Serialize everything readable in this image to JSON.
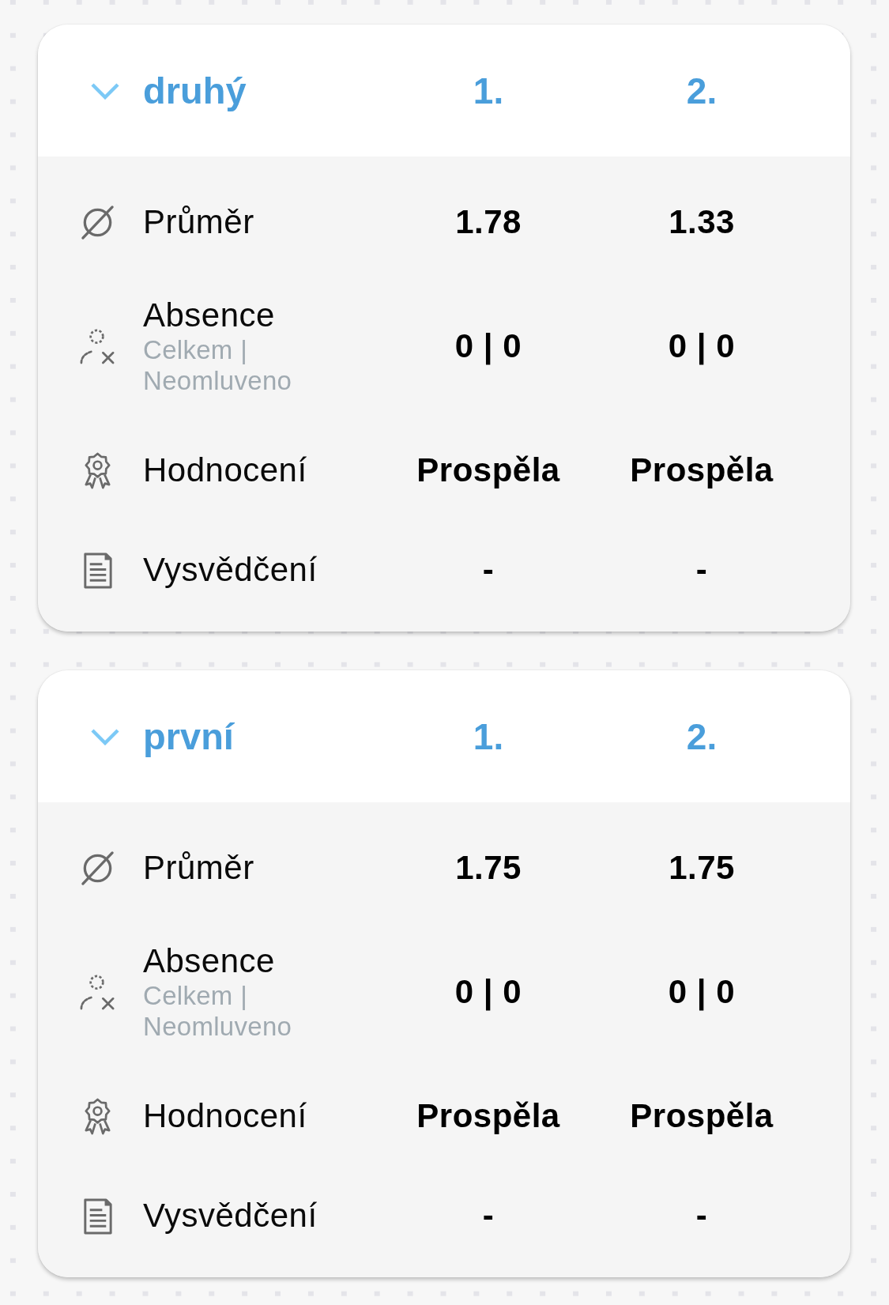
{
  "cards": [
    {
      "title": "druhý",
      "expanded": true,
      "columns": [
        "1.",
        "2."
      ],
      "rows": [
        {
          "kind": "average",
          "label": "Průměr",
          "values": [
            "1.78",
            "1.33"
          ]
        },
        {
          "kind": "absence",
          "label": "Absence",
          "sublabel": "Celkem | Neomluveno",
          "values": [
            "0 | 0",
            "0 | 0"
          ]
        },
        {
          "kind": "grade",
          "label": "Hodnocení",
          "values": [
            "Prospěla",
            "Prospěla"
          ]
        },
        {
          "kind": "certificate",
          "label": "Vysvědčení",
          "values": [
            "-",
            "-"
          ]
        }
      ]
    },
    {
      "title": "první",
      "expanded": true,
      "columns": [
        "1.",
        "2."
      ],
      "rows": [
        {
          "kind": "average",
          "label": "Průměr",
          "values": [
            "1.75",
            "1.75"
          ]
        },
        {
          "kind": "absence",
          "label": "Absence",
          "sublabel": "Celkem | Neomluveno",
          "values": [
            "0 | 0",
            "0 | 0"
          ]
        },
        {
          "kind": "grade",
          "label": "Hodnocení",
          "values": [
            "Prospěla",
            "Prospěla"
          ]
        },
        {
          "kind": "certificate",
          "label": "Vysvědčení",
          "values": [
            "-",
            "-"
          ]
        }
      ]
    }
  ]
}
